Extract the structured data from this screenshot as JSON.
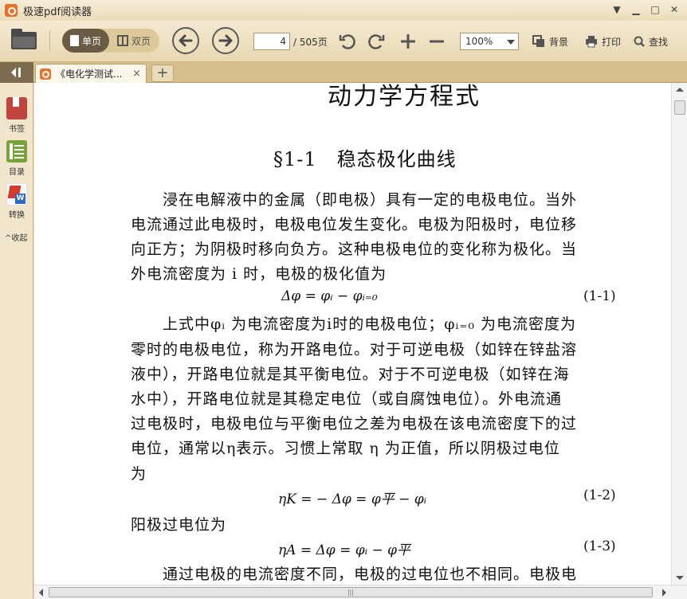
{
  "window": {
    "title": "极速pdf阅读器"
  },
  "toolbar": {
    "single_page": "单页",
    "dual_page": "双页",
    "page_current": "4",
    "page_total": "/ 505页",
    "zoom": "100%",
    "background": "背景",
    "print": "打印",
    "search": "查找"
  },
  "tab": {
    "label": "《电化学测试...",
    "close": "×",
    "add": "+"
  },
  "sidebar": {
    "bookmark": "书签",
    "toc": "目录",
    "convert": "转换",
    "collapse": "^收起"
  },
  "document": {
    "heading_cut": "动力学方程式",
    "section_title": "§1-1　稳态极化曲线",
    "lines": [
      "　　浸在电解液中的金属（即电极）具有一定的电极电位。当外",
      "电流通过此电极时，电极电位发生变化。电极为阳极时，电位移",
      "向正方；为阴极时移向负方。这种电极电位的变化称为极化。当",
      "外电流密度为 i 时，电极的极化值为",
      "　　上式中φᵢ 为电流密度为i时的电极电位；φᵢ₌₀ 为电流密度为",
      "零时的电极电位，称为开路电位。对于可逆电极（如锌在锌盐溶",
      "液中），开路电位就是其平衡电位。对于不可逆电极（如锌在海",
      "水中），开路电位就是其稳定电位（或自腐蚀电位）。外电流通",
      "过电极时，电极电位与平衡电位之差为电极在该电流密度下的过",
      "电位，通常以η表示。习惯上常取 η 为正值，所以阴极过电位",
      "为",
      "阳极过电位为",
      "　　通过电极的电流密度不同，电极的过电位也不相同。电极电"
    ],
    "equations": [
      {
        "expr": "Δφ = φᵢ − φᵢ₌₀",
        "num": "(1-1)"
      },
      {
        "expr": "ηK = − Δφ = φ平 − φᵢ",
        "num": "(1-2)"
      },
      {
        "expr": "ηA = Δφ = φᵢ − φ平",
        "num": "(1-3)"
      }
    ]
  },
  "colors": {
    "accent": "#e8712b",
    "frame": "#e9d9b4",
    "active_mode": "#6a5b45"
  }
}
